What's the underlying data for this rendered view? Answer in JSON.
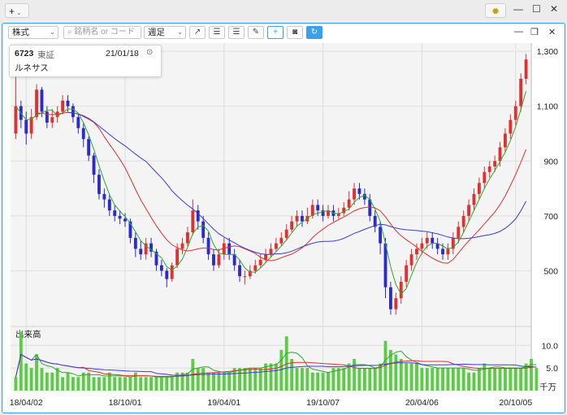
{
  "topbar": {
    "add_label": "+",
    "gear_icon": "gear-icon"
  },
  "toolbar": {
    "type_select": "株式",
    "search_placeholder": "銘柄名 or コード",
    "period_select": "週足",
    "icons": [
      "arrow-up-right-icon",
      "align-left-icon",
      "align-right-icon",
      "pencil-icon",
      "crosshair-icon",
      "camera-icon",
      "refresh-icon"
    ]
  },
  "info": {
    "code": "6723",
    "market": "東証",
    "date": "21/01/18",
    "name": "ルネサス"
  },
  "volume_label": "出来高",
  "volume_unit": "千万",
  "colors": {
    "up": "#e23030",
    "down": "#2a2acd",
    "ma_short": "#2ea82e",
    "ma_mid": "#e03030",
    "ma_long": "#3b3bd6",
    "volume": "#5ccc46",
    "accent": "#3aa0ea"
  },
  "chart_data": {
    "type": "candlestick",
    "x_ticks": [
      "18/04/02",
      "18/10/01",
      "19/04/01",
      "19/10/07",
      "20/04/06",
      "20/10/05"
    ],
    "price_ticks": [
      "1,300",
      "1,100",
      "900",
      "700",
      "500"
    ],
    "price_range": [
      300,
      1330
    ],
    "volume_ticks": [
      "10.0",
      "5.0"
    ],
    "volume_range": [
      0,
      14
    ],
    "candles": [
      [
        1000,
        1100,
        1220,
        980
      ],
      [
        1100,
        1050,
        1120,
        1020
      ],
      [
        1050,
        1000,
        1080,
        960
      ],
      [
        1000,
        1060,
        1090,
        980
      ],
      [
        1060,
        1160,
        1180,
        1050
      ],
      [
        1160,
        1080,
        1170,
        1060
      ],
      [
        1080,
        1040,
        1100,
        1020
      ],
      [
        1040,
        1060,
        1090,
        1020
      ],
      [
        1060,
        1080,
        1100,
        1040
      ],
      [
        1080,
        1120,
        1140,
        1070
      ],
      [
        1120,
        1100,
        1140,
        1080
      ],
      [
        1100,
        1060,
        1110,
        1040
      ],
      [
        1060,
        1020,
        1070,
        1000
      ],
      [
        1020,
        980,
        1040,
        950
      ],
      [
        980,
        920,
        990,
        900
      ],
      [
        920,
        850,
        930,
        820
      ],
      [
        850,
        780,
        870,
        760
      ],
      [
        780,
        760,
        800,
        730
      ],
      [
        760,
        720,
        780,
        700
      ],
      [
        720,
        700,
        740,
        680
      ],
      [
        700,
        690,
        720,
        670
      ],
      [
        690,
        680,
        710,
        660
      ],
      [
        680,
        620,
        690,
        600
      ],
      [
        620,
        580,
        640,
        550
      ],
      [
        580,
        560,
        610,
        540
      ],
      [
        560,
        600,
        620,
        540
      ],
      [
        600,
        570,
        620,
        550
      ],
      [
        570,
        520,
        580,
        500
      ],
      [
        520,
        500,
        540,
        480
      ],
      [
        500,
        470,
        510,
        440
      ],
      [
        470,
        520,
        530,
        460
      ],
      [
        520,
        580,
        600,
        510
      ],
      [
        580,
        600,
        620,
        560
      ],
      [
        600,
        640,
        660,
        590
      ],
      [
        640,
        720,
        760,
        630
      ],
      [
        720,
        680,
        740,
        650
      ],
      [
        680,
        620,
        700,
        600
      ],
      [
        620,
        560,
        640,
        540
      ],
      [
        560,
        520,
        580,
        500
      ],
      [
        520,
        560,
        580,
        510
      ],
      [
        560,
        600,
        620,
        540
      ],
      [
        600,
        560,
        620,
        540
      ],
      [
        560,
        520,
        580,
        500
      ],
      [
        520,
        480,
        540,
        460
      ],
      [
        480,
        480,
        500,
        450
      ],
      [
        480,
        500,
        520,
        470
      ],
      [
        500,
        520,
        540,
        490
      ],
      [
        520,
        540,
        560,
        510
      ],
      [
        540,
        560,
        580,
        530
      ],
      [
        560,
        580,
        600,
        550
      ],
      [
        580,
        600,
        620,
        570
      ],
      [
        600,
        620,
        640,
        590
      ],
      [
        620,
        650,
        670,
        610
      ],
      [
        650,
        680,
        700,
        640
      ],
      [
        680,
        700,
        720,
        660
      ],
      [
        700,
        680,
        720,
        660
      ],
      [
        680,
        700,
        730,
        670
      ],
      [
        700,
        740,
        760,
        690
      ],
      [
        740,
        720,
        760,
        700
      ],
      [
        720,
        700,
        740,
        680
      ],
      [
        700,
        720,
        740,
        690
      ],
      [
        720,
        700,
        740,
        680
      ],
      [
        700,
        710,
        730,
        690
      ],
      [
        710,
        730,
        750,
        700
      ],
      [
        730,
        760,
        790,
        720
      ],
      [
        760,
        800,
        820,
        740
      ],
      [
        800,
        780,
        820,
        760
      ],
      [
        780,
        760,
        800,
        740
      ],
      [
        760,
        700,
        780,
        680
      ],
      [
        700,
        660,
        720,
        640
      ],
      [
        660,
        600,
        680,
        560
      ],
      [
        600,
        440,
        620,
        400
      ],
      [
        440,
        360,
        460,
        340
      ],
      [
        360,
        400,
        420,
        340
      ],
      [
        400,
        460,
        480,
        380
      ],
      [
        460,
        520,
        540,
        440
      ],
      [
        520,
        560,
        580,
        500
      ],
      [
        560,
        580,
        600,
        540
      ],
      [
        580,
        600,
        620,
        560
      ],
      [
        600,
        620,
        640,
        580
      ],
      [
        620,
        600,
        640,
        580
      ],
      [
        600,
        580,
        620,
        560
      ],
      [
        580,
        560,
        600,
        540
      ],
      [
        560,
        580,
        600,
        540
      ],
      [
        580,
        620,
        640,
        560
      ],
      [
        620,
        660,
        680,
        600
      ],
      [
        660,
        700,
        720,
        640
      ],
      [
        700,
        740,
        760,
        680
      ],
      [
        740,
        780,
        800,
        720
      ],
      [
        780,
        820,
        840,
        760
      ],
      [
        820,
        860,
        880,
        800
      ],
      [
        860,
        880,
        900,
        840
      ],
      [
        880,
        900,
        920,
        860
      ],
      [
        900,
        950,
        970,
        880
      ],
      [
        950,
        1000,
        1020,
        930
      ],
      [
        1000,
        1050,
        1070,
        980
      ],
      [
        1050,
        1100,
        1120,
        1030
      ],
      [
        1100,
        1200,
        1220,
        1080
      ],
      [
        1200,
        1270,
        1290,
        1180
      ]
    ],
    "volumes": [
      3,
      13,
      6,
      5,
      8,
      5,
      4,
      4,
      5,
      3,
      4,
      3,
      3,
      4,
      4,
      3,
      3,
      3,
      4,
      3,
      3,
      3,
      3,
      4,
      3,
      3,
      3,
      3,
      3,
      3,
      3,
      4,
      4,
      4,
      7,
      5,
      5,
      4,
      4,
      4,
      4,
      4,
      5,
      5,
      5,
      5,
      5,
      5,
      6,
      6,
      6,
      9,
      12,
      7,
      5,
      5,
      5,
      4,
      4,
      4,
      4,
      5,
      5,
      5,
      6,
      7,
      5,
      5,
      5,
      5,
      6,
      11,
      9,
      8,
      7,
      6,
      6,
      6,
      5,
      5,
      5,
      5,
      5,
      5,
      5,
      5,
      5,
      4,
      4,
      5,
      6,
      5,
      5,
      5,
      5,
      5,
      5,
      5,
      6,
      7,
      5
    ]
  }
}
